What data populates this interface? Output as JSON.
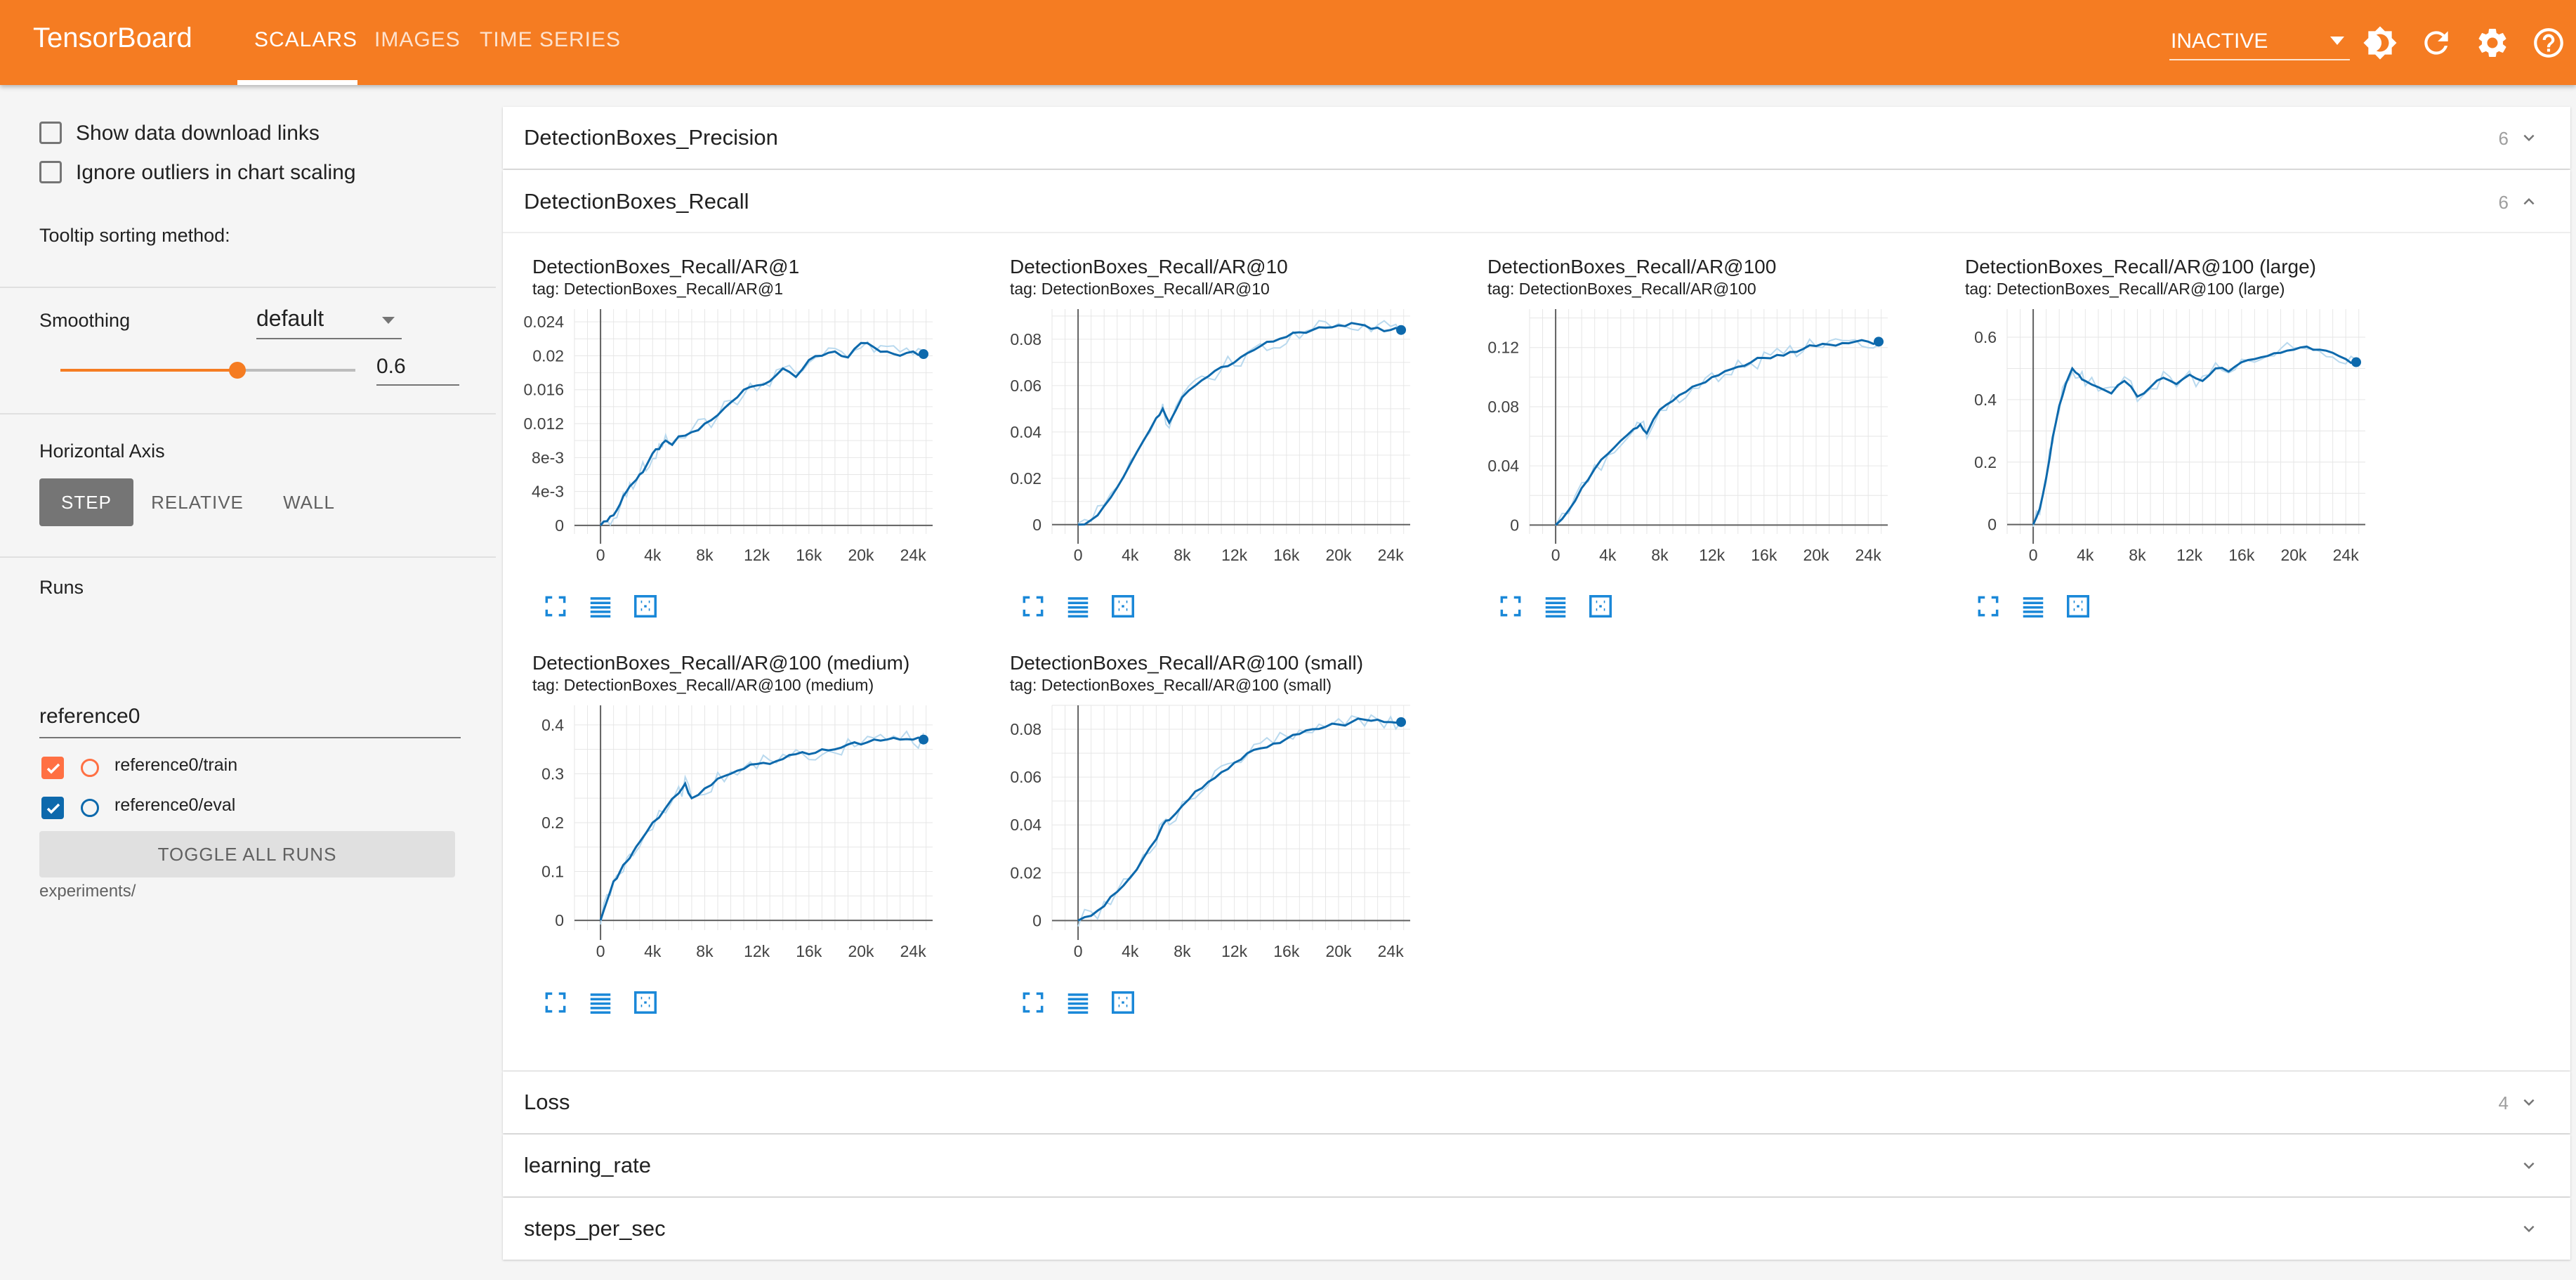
{
  "app": {
    "brand": "TensorBoard",
    "nav_tabs": [
      "SCALARS",
      "IMAGES",
      "TIME SERIES"
    ],
    "active_tab": "SCALARS",
    "status": "INACTIVE",
    "icons": [
      "brightness-icon",
      "refresh-icon",
      "settings-icon",
      "help-icon"
    ]
  },
  "sidebar": {
    "show_download_links": "Show data download links",
    "ignore_outliers": "Ignore outliers in chart scaling",
    "tooltip_label": "Tooltip sorting method:",
    "tooltip_value": "default",
    "smoothing_label": "Smoothing",
    "smoothing_value": "0.6",
    "smoothing_fraction": 0.6,
    "horizontal_axis_label": "Horizontal Axis",
    "axis_options": [
      "STEP",
      "RELATIVE",
      "WALL"
    ],
    "axis_selected": "STEP",
    "runs_label": "Runs",
    "runs_filter": "reference0",
    "runs": [
      {
        "name": "reference0/train",
        "checked": true,
        "color": "#ff7043"
      },
      {
        "name": "reference0/eval",
        "checked": true,
        "color": "#0d69ac"
      }
    ],
    "toggle_all": "TOGGLE ALL RUNS",
    "logdir": "experiments/"
  },
  "groups": [
    {
      "title": "DetectionBoxes_Precision",
      "count": "6",
      "expanded": false
    },
    {
      "title": "DetectionBoxes_Recall",
      "count": "6",
      "expanded": true
    },
    {
      "title": "Loss",
      "count": "4",
      "expanded": false
    },
    {
      "title": "learning_rate",
      "count": "",
      "expanded": false
    },
    {
      "title": "steps_per_sec",
      "count": "",
      "expanded": false
    }
  ],
  "colors": {
    "accent": "#f57c22",
    "series": "#0d69ac",
    "series_raw": "#b9d9ee"
  },
  "chart_data": [
    {
      "type": "line",
      "title": "DetectionBoxes_Recall/AR@1",
      "tag": "tag: DetectionBoxes_Recall/AR@1",
      "x_ticks": [
        "0",
        "4k",
        "8k",
        "12k",
        "16k",
        "20k",
        "24k"
      ],
      "y_ticks": [
        "0",
        "4e-3",
        "8e-3",
        "0.012",
        "0.016",
        "0.02",
        "0.024"
      ],
      "y_tick_values": [
        0,
        0.004,
        0.008,
        0.012,
        0.016,
        0.02,
        0.024
      ],
      "xlim": [
        -2000,
        25500
      ],
      "ylim": [
        -0.001,
        0.0255
      ],
      "series": [
        {
          "x": [
            0,
            500,
            1000,
            1500,
            2000,
            2500,
            3000,
            3500,
            4000,
            4500,
            5000,
            5500,
            6000,
            7000,
            8000,
            9000,
            10000,
            11000,
            12000,
            13000,
            14000,
            15000,
            16000,
            17000,
            18000,
            19000,
            20000,
            21000,
            22000,
            23000,
            24000,
            24800
          ],
          "y": [
            0,
            0.0005,
            0.0012,
            0.0025,
            0.004,
            0.005,
            0.006,
            0.007,
            0.0085,
            0.009,
            0.01,
            0.0095,
            0.0105,
            0.011,
            0.012,
            0.013,
            0.0145,
            0.016,
            0.0165,
            0.017,
            0.0185,
            0.0175,
            0.0195,
            0.02,
            0.0205,
            0.0198,
            0.0215,
            0.021,
            0.0205,
            0.02,
            0.0205,
            0.0202
          ]
        }
      ]
    },
    {
      "type": "line",
      "title": "DetectionBoxes_Recall/AR@10",
      "tag": "tag: DetectionBoxes_Recall/AR@10",
      "x_ticks": [
        "0",
        "4k",
        "8k",
        "12k",
        "16k",
        "20k",
        "24k"
      ],
      "y_ticks": [
        "0",
        "0.02",
        "0.04",
        "0.06",
        "0.08"
      ],
      "y_tick_values": [
        0,
        0.02,
        0.04,
        0.06,
        0.08
      ],
      "xlim": [
        -2000,
        25500
      ],
      "ylim": [
        -0.004,
        0.093
      ],
      "series": [
        {
          "x": [
            0,
            1000,
            2000,
            3000,
            4000,
            5000,
            6000,
            6500,
            7000,
            8000,
            9000,
            10000,
            11000,
            12000,
            13000,
            14000,
            15000,
            16000,
            17000,
            18000,
            19000,
            20000,
            21000,
            22000,
            23000,
            24000,
            24800
          ],
          "y": [
            0,
            0.002,
            0.008,
            0.016,
            0.026,
            0.036,
            0.046,
            0.05,
            0.044,
            0.055,
            0.06,
            0.064,
            0.068,
            0.07,
            0.074,
            0.077,
            0.079,
            0.081,
            0.083,
            0.084,
            0.085,
            0.086,
            0.087,
            0.086,
            0.085,
            0.084,
            0.084
          ]
        }
      ]
    },
    {
      "type": "line",
      "title": "DetectionBoxes_Recall/AR@100",
      "tag": "tag: DetectionBoxes_Recall/AR@100",
      "x_ticks": [
        "0",
        "4k",
        "8k",
        "12k",
        "16k",
        "20k",
        "24k"
      ],
      "y_ticks": [
        "0",
        "0.04",
        "0.08",
        "0.12"
      ],
      "y_tick_values": [
        0,
        0.04,
        0.08,
        0.12
      ],
      "xlim": [
        -2000,
        25500
      ],
      "ylim": [
        -0.006,
        0.146
      ],
      "series": [
        {
          "x": [
            0,
            1000,
            2000,
            3000,
            4000,
            5000,
            6000,
            6500,
            7000,
            8000,
            9000,
            10000,
            11000,
            12000,
            13000,
            14000,
            15000,
            16000,
            17000,
            18000,
            19000,
            20000,
            21000,
            22000,
            23000,
            24000,
            24800
          ],
          "y": [
            0,
            0.01,
            0.025,
            0.038,
            0.048,
            0.057,
            0.065,
            0.068,
            0.062,
            0.078,
            0.084,
            0.09,
            0.095,
            0.1,
            0.104,
            0.107,
            0.11,
            0.113,
            0.115,
            0.117,
            0.119,
            0.121,
            0.122,
            0.123,
            0.124,
            0.124,
            0.124
          ]
        }
      ]
    },
    {
      "type": "line",
      "title": "DetectionBoxes_Recall/AR@100 (large)",
      "tag": "tag: DetectionBoxes_Recall/AR@100 (large)",
      "x_ticks": [
        "0",
        "4k",
        "8k",
        "12k",
        "16k",
        "20k",
        "24k"
      ],
      "y_ticks": [
        "0",
        "0.2",
        "0.4",
        "0.6"
      ],
      "y_tick_values": [
        0,
        0.2,
        0.4,
        0.6
      ],
      "xlim": [
        -2000,
        25500
      ],
      "ylim": [
        -0.03,
        0.69
      ],
      "series": [
        {
          "x": [
            0,
            500,
            1000,
            1500,
            2000,
            2500,
            3000,
            3500,
            4000,
            5000,
            6000,
            7000,
            8000,
            9000,
            10000,
            11000,
            12000,
            13000,
            14000,
            15000,
            16000,
            17000,
            18000,
            19000,
            20000,
            21000,
            22000,
            23000,
            24000,
            24800
          ],
          "y": [
            0,
            0.05,
            0.15,
            0.28,
            0.38,
            0.45,
            0.5,
            0.48,
            0.46,
            0.44,
            0.42,
            0.46,
            0.41,
            0.44,
            0.47,
            0.45,
            0.48,
            0.46,
            0.5,
            0.49,
            0.52,
            0.53,
            0.54,
            0.55,
            0.56,
            0.57,
            0.56,
            0.55,
            0.53,
            0.52
          ]
        }
      ]
    },
    {
      "type": "line",
      "title": "DetectionBoxes_Recall/AR@100 (medium)",
      "tag": "tag: DetectionBoxes_Recall/AR@100 (medium)",
      "x_ticks": [
        "0",
        "4k",
        "8k",
        "12k",
        "16k",
        "20k",
        "24k"
      ],
      "y_ticks": [
        "0",
        "0.1",
        "0.2",
        "0.3",
        "0.4"
      ],
      "y_tick_values": [
        0,
        0.1,
        0.2,
        0.3,
        0.4
      ],
      "xlim": [
        -2000,
        25500
      ],
      "ylim": [
        -0.02,
        0.44
      ],
      "series": [
        {
          "x": [
            0,
            500,
            1000,
            1500,
            2000,
            2500,
            3000,
            4000,
            5000,
            6000,
            6500,
            7000,
            8000,
            9000,
            10000,
            11000,
            12000,
            13000,
            14000,
            15000,
            16000,
            17000,
            18000,
            19000,
            20000,
            21000,
            22000,
            23000,
            24000,
            24800
          ],
          "y": [
            0,
            0.04,
            0.08,
            0.1,
            0.12,
            0.14,
            0.16,
            0.2,
            0.23,
            0.26,
            0.28,
            0.25,
            0.27,
            0.29,
            0.3,
            0.31,
            0.32,
            0.32,
            0.33,
            0.34,
            0.34,
            0.35,
            0.35,
            0.36,
            0.36,
            0.37,
            0.37,
            0.37,
            0.37,
            0.37
          ]
        }
      ]
    },
    {
      "type": "line",
      "title": "DetectionBoxes_Recall/AR@100 (small)",
      "tag": "tag: DetectionBoxes_Recall/AR@100 (small)",
      "x_ticks": [
        "0",
        "4k",
        "8k",
        "12k",
        "16k",
        "20k",
        "24k"
      ],
      "y_ticks": [
        "0",
        "0.02",
        "0.04",
        "0.06",
        "0.08"
      ],
      "y_tick_values": [
        0,
        0.02,
        0.04,
        0.06,
        0.08
      ],
      "xlim": [
        -2000,
        25500
      ],
      "ylim": [
        -0.004,
        0.09
      ],
      "series": [
        {
          "x": [
            0,
            1000,
            2000,
            3000,
            4000,
            5000,
            6000,
            6500,
            7000,
            8000,
            9000,
            10000,
            11000,
            12000,
            13000,
            14000,
            15000,
            16000,
            17000,
            18000,
            19000,
            20000,
            21000,
            22000,
            23000,
            24000,
            24800
          ],
          "y": [
            0,
            0.002,
            0.006,
            0.012,
            0.018,
            0.026,
            0.034,
            0.04,
            0.042,
            0.048,
            0.054,
            0.058,
            0.062,
            0.066,
            0.07,
            0.072,
            0.074,
            0.076,
            0.078,
            0.08,
            0.081,
            0.082,
            0.083,
            0.084,
            0.084,
            0.083,
            0.083
          ]
        }
      ]
    }
  ]
}
